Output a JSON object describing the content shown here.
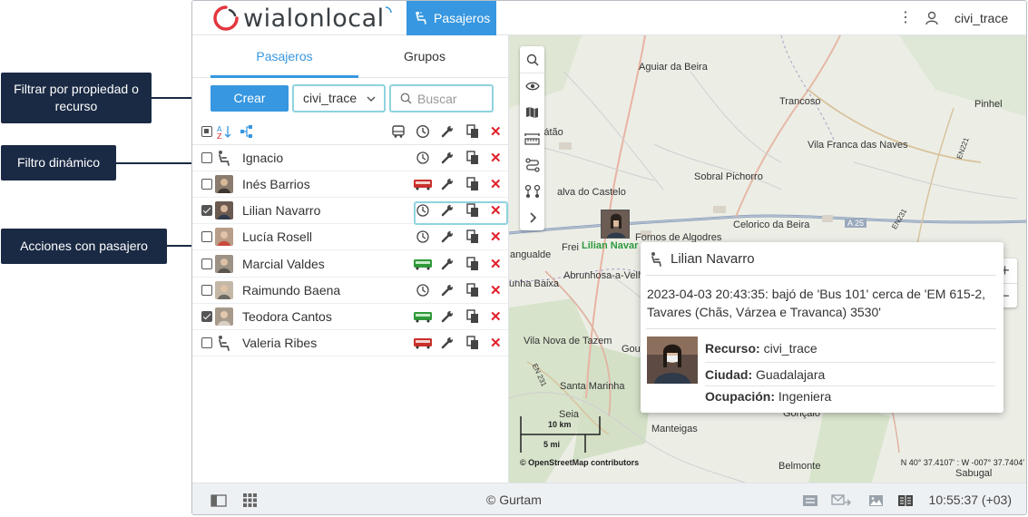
{
  "app": {
    "logo_text": "wialonlocal",
    "module_label": "Pasajeros",
    "user_name": "civi_trace"
  },
  "tabs": {
    "passengers": "Pasajeros",
    "groups": "Grupos"
  },
  "toolbar": {
    "create_label": "Crear",
    "resource_value": "civi_trace",
    "search_placeholder": "Buscar"
  },
  "passengers": [
    {
      "name": "Ignacio",
      "checked": false,
      "avatar": "seat-icon",
      "actions": [
        "history",
        "edit",
        "copy",
        "delete"
      ]
    },
    {
      "name": "Inés Barrios",
      "checked": false,
      "avatar": "photo",
      "actions": [
        "bus-red",
        "edit",
        "copy",
        "delete"
      ]
    },
    {
      "name": "Lilian Navarro",
      "checked": true,
      "avatar": "photo",
      "actions": [
        "history",
        "edit",
        "copy",
        "delete"
      ]
    },
    {
      "name": "Lucía Rosell",
      "checked": false,
      "avatar": "photo",
      "actions": [
        "history",
        "edit",
        "copy",
        "delete"
      ]
    },
    {
      "name": "Marcial Valdes",
      "checked": false,
      "avatar": "photo",
      "actions": [
        "bus-green",
        "edit",
        "copy",
        "delete"
      ]
    },
    {
      "name": "Raimundo Baena",
      "checked": false,
      "avatar": "photo",
      "actions": [
        "history",
        "edit",
        "copy",
        "delete"
      ]
    },
    {
      "name": "Teodora Cantos",
      "checked": true,
      "avatar": "photo",
      "actions": [
        "bus-green",
        "edit",
        "copy",
        "delete"
      ]
    },
    {
      "name": "Valeria Ribes",
      "checked": false,
      "avatar": "seat-icon",
      "actions": [
        "bus-red",
        "edit",
        "copy",
        "delete"
      ]
    }
  ],
  "map": {
    "towns": [
      "Aguiar da Beira",
      "Trancoso",
      "Pinhel",
      "Sátão",
      "Vila Franca das Naves",
      "Sobral Pichorro",
      "alva do Castelo",
      "Celorico da Beira",
      "Fornos de Algodres",
      "Frei",
      "angualde",
      "Abrunhosa-a-Velh",
      "unha Baixa",
      "Vila Nova de Tazem",
      "Gou",
      "Santa Marinha",
      "Seia",
      "Manteigas",
      "Gonçalo",
      "Belmonte",
      "Sabugal",
      "A 25",
      "EN221",
      "EN 231",
      "EN231"
    ],
    "marker_label": "Lilian Navar",
    "scale_km": "10 km",
    "scale_mi": "5 mi",
    "attribution": "© OpenStreetMap contributors",
    "coords": "N 40° 37.4107' : W -007° 37.7404'"
  },
  "popup": {
    "title": "Lilian Navarro",
    "message": "2023-04-03 20:43:35: bajó de 'Bus 101' cerca de 'EM 615-2, Tavares (Chãs, Várzea e Travanca) 3530'",
    "resource_label": "Recurso:",
    "resource_value": "civi_trace",
    "city_label": "Ciudad:",
    "city_value": "Guadalajara",
    "occupation_label": "Ocupación:",
    "occupation_value": "Ingeniera"
  },
  "bottom": {
    "copyright": "© Gurtam",
    "clock": "10:55:37 (+03)"
  },
  "callouts": {
    "filter_property": "Filtrar por propiedad o recurso",
    "dynamic_filter": "Filtro dinámico",
    "passenger_actions": "Acciones con pasajero"
  },
  "colors": {
    "accent": "#3797e0",
    "highlight": "#8fd3de",
    "delete": "#e0202a",
    "callout_bg": "#1a2a44",
    "marker_label": "#2e9a3e"
  }
}
